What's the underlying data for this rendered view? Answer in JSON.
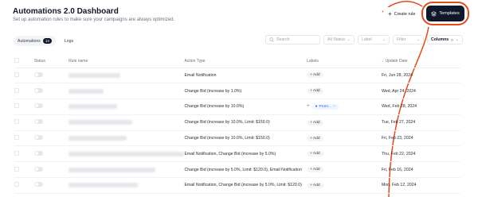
{
  "header": {
    "title": "Automations 2.0 Dashboard",
    "subtitle": "Set up automation rules to make sure your campaigns are always optimized.",
    "create_label": "Create rule",
    "templates_label": "Templates"
  },
  "tabs": [
    {
      "label": "Automations",
      "count": "13"
    },
    {
      "label": "Logs"
    }
  ],
  "filters": {
    "search_placeholder": "Search",
    "status_placeholder": "All Status",
    "label_placeholder": "Label",
    "filter_placeholder": "Filter",
    "columns_label": "Columns",
    "columns_count": "0"
  },
  "table": {
    "headers": {
      "status": "Status",
      "rule_name": "Rule name",
      "action_type": "Action Type",
      "labels": "Labels",
      "date": "Update Date"
    },
    "add_label": "Add",
    "rows": [
      {
        "action": "Email Notification",
        "date": "Fri, Jun 28, 2024",
        "label": "add",
        "blur": 0.45
      },
      {
        "action": "Change Bid (increase by 1.0%)",
        "date": "Wed, Apr 24, 2024",
        "label": "add",
        "blur": 0.3
      },
      {
        "action": "Change Bid (increase by 10.0%)",
        "date": "Wed, Feb 28, 2024",
        "label": "chip",
        "chip": "Prom...",
        "blur": 0.42
      },
      {
        "action": "Change Bid (increase by 10.0%, Limit: $150.0)",
        "date": "Tue, Feb 27, 2024",
        "label": "add",
        "blur": 0.55
      },
      {
        "action": "Change Bid (increase by 10.0%, Limit: $150.0)",
        "date": "Fri, Feb 23, 2024",
        "label": "add",
        "blur": 0.5
      },
      {
        "action": "Email Notification, Change Bid (increase by 5.0%)",
        "date": "Thu, Feb 22, 2024",
        "label": "add",
        "blur": 1.0
      },
      {
        "action": "Change Bid (increase by 5.0%, Limit: $120.0), Email Notification",
        "date": "Fri, Feb 16, 2024",
        "label": "add",
        "blur": 0.75
      },
      {
        "action": "Email Notification, Change Bid (increase by 5.0%, Limit: $120.0)",
        "date": "Mon, Feb 12, 2024",
        "label": "add",
        "blur": 0.6
      }
    ]
  },
  "colors": {
    "templates_bg": "#0f172a",
    "callout": "#e64a19",
    "chip_text": "#2563eb"
  }
}
